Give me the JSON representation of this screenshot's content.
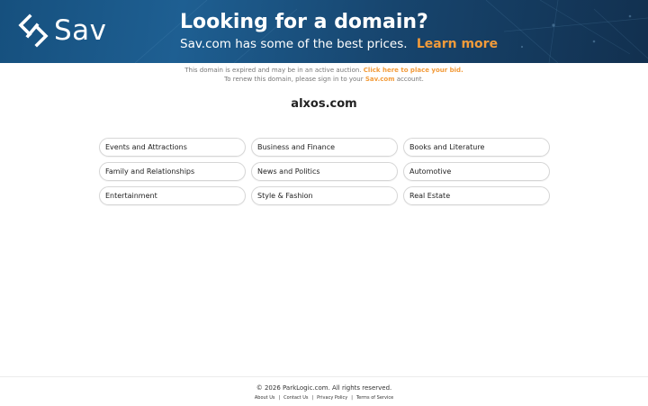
{
  "banner": {
    "logo_text": "Sav",
    "headline": "Looking for a domain?",
    "subline": "Sav.com has some of the best prices.",
    "learn_more": "Learn more",
    "accent_color": "#f29b3a",
    "background_color": "#1a4f7e"
  },
  "notice": {
    "line1_text": "This domain is expired and may be in an active auction. ",
    "line1_link": "Click here to place your bid.",
    "line2_before": "To renew this domain, please sign in to your ",
    "line2_link": "Sav.com",
    "line2_after": " account."
  },
  "domain_name": "alxos.com",
  "categories": [
    "Events and Attractions",
    "Business and Finance",
    "Books and Literature",
    "Family and Relationships",
    "News and Politics",
    "Automotive",
    "Entertainment",
    "Style & Fashion",
    "Real Estate"
  ],
  "footer": {
    "copyright": "© 2026 ParkLogic.com. All rights reserved.",
    "links": [
      "About Us",
      "Contact Us",
      "Privacy Policy",
      "Terms of Service"
    ],
    "separator": "|"
  },
  "icons": {
    "logo_mark": "sav-logo-icon"
  }
}
